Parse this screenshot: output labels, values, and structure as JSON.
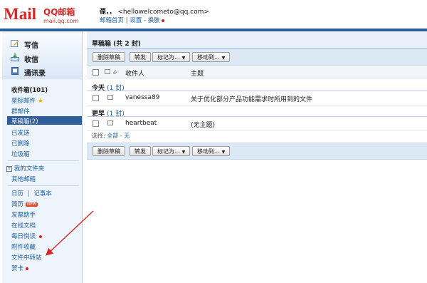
{
  "header": {
    "logo": {
      "brand": "Mail",
      "qq": "QQ邮箱",
      "domain": "mail.qq.com"
    },
    "user_name": "葆，，",
    "user_email": "<hellowelcometo@qq.com>",
    "links": {
      "home": "邮箱首页",
      "sep": "|",
      "settings": "设置",
      "dash": "-",
      "switch": "换肤"
    }
  },
  "sidebar": {
    "quick": [
      {
        "label": "写信",
        "icon": "pencil-icon"
      },
      {
        "label": "收信",
        "icon": "inbox-download-icon"
      },
      {
        "label": "通讯录",
        "icon": "address-book-icon"
      }
    ],
    "inbox": "收件箱(101)",
    "starred": "星标邮件",
    "group": "群邮件",
    "drafts": "草稿箱(2)",
    "sent": "已发送",
    "deleted": "已删除",
    "trash": "垃圾箱",
    "my_folders": "我的文件夹",
    "other_mailbox": "其他邮箱",
    "calendar": "日历",
    "bar": "|",
    "notepad": "记事本",
    "resume": "简历",
    "new_badge": "NEW",
    "mass_assistant": "发票助手",
    "online_docs": "在线文档",
    "daily_read": "每日悦读",
    "attachments": "附件收藏",
    "file_transfer": "文件中转站",
    "cards": "贺卡"
  },
  "main": {
    "title": "草稿箱 (共 2 封)",
    "toolbar": {
      "delete": "删除草稿",
      "forward": "转发",
      "mark_as": "标记为...",
      "move_to": "移动到..."
    },
    "columns": {
      "recipient": "收件人",
      "subject": "主题"
    },
    "groups": [
      {
        "label": "今天",
        "count": "(1 封)",
        "rows": [
          {
            "recipient": "vanessa89",
            "subject": "关于优化部分产品功能需求时所用到的文件"
          }
        ]
      },
      {
        "label": "更早",
        "count": "(1 封)",
        "rows": [
          {
            "recipient": "heartbeat",
            "subject": "(无主题)"
          }
        ]
      }
    ],
    "select": {
      "label": "选择:",
      "all": "全部",
      "dash": "-",
      "none": "无"
    }
  },
  "colors": {
    "accent": "#2e5d9a",
    "brand": "#d62828",
    "link": "#1b5fa8",
    "annotation": "#e02020"
  }
}
